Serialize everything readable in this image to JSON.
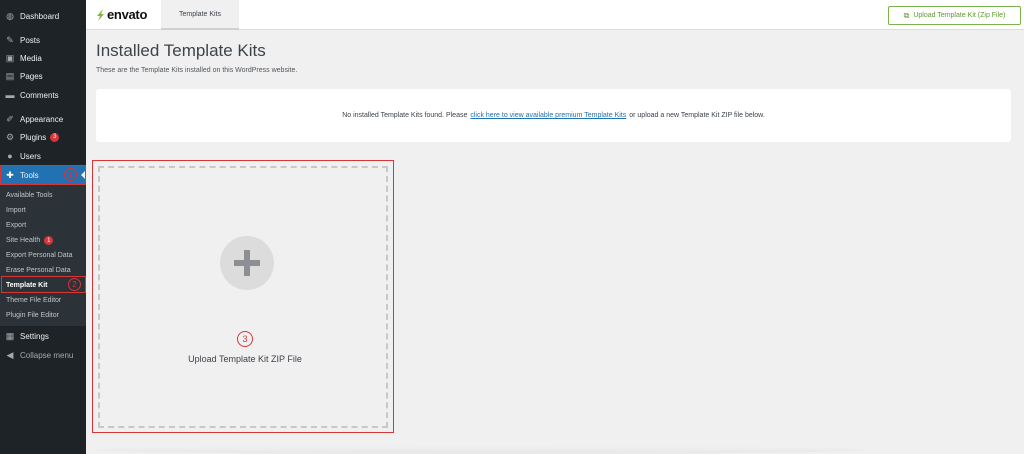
{
  "sidebar": {
    "items": [
      {
        "label": "Dashboard",
        "icon": "dashboard-icon",
        "glyph": "◍"
      },
      {
        "label": "Posts",
        "icon": "pushpin-icon",
        "glyph": "✎"
      },
      {
        "label": "Media",
        "icon": "media-icon",
        "glyph": "▣"
      },
      {
        "label": "Pages",
        "icon": "pages-icon",
        "glyph": "▤"
      },
      {
        "label": "Comments",
        "icon": "comments-icon",
        "glyph": "▬"
      },
      {
        "label": "Appearance",
        "icon": "paintbrush-icon",
        "glyph": "✐"
      },
      {
        "label": "Plugins",
        "icon": "plugins-icon",
        "glyph": "⚙",
        "badge": "3"
      },
      {
        "label": "Users",
        "icon": "users-icon",
        "glyph": "●"
      },
      {
        "label": "Tools",
        "icon": "wrench-icon",
        "glyph": "✚"
      },
      {
        "label": "Settings",
        "icon": "settings-icon",
        "glyph": "▦"
      },
      {
        "label": "Collapse menu",
        "icon": "collapse-icon",
        "glyph": "◀"
      }
    ],
    "submenu": [
      {
        "label": "Available Tools"
      },
      {
        "label": "Import"
      },
      {
        "label": "Export"
      },
      {
        "label": "Site Health",
        "badge": "1"
      },
      {
        "label": "Export Personal Data"
      },
      {
        "label": "Erase Personal Data"
      },
      {
        "label": "Template Kit"
      },
      {
        "label": "Theme File Editor"
      },
      {
        "label": "Plugin File Editor"
      }
    ],
    "annotations": {
      "tools": "1",
      "template_kit": "2"
    }
  },
  "topbar": {
    "logo": "envato",
    "tab": "Template Kits",
    "upload_button": "Upload Template Kit (Zip File)"
  },
  "main": {
    "title": "Installed Template Kits",
    "description": "These are the Template Kits installed on this WordPress website.",
    "notice": {
      "before": "No installed Template Kits found. Please",
      "link": "click here to view available premium Template Kits",
      "after": "or upload a new Template Kit ZIP file below."
    },
    "upload_card": {
      "annotation": "3",
      "label": "Upload Template Kit ZIP File"
    }
  },
  "colors": {
    "accent": "#2271b1",
    "sidebar": "#1d2327",
    "annotation": "#d63638",
    "envato_green": "#82b540"
  }
}
